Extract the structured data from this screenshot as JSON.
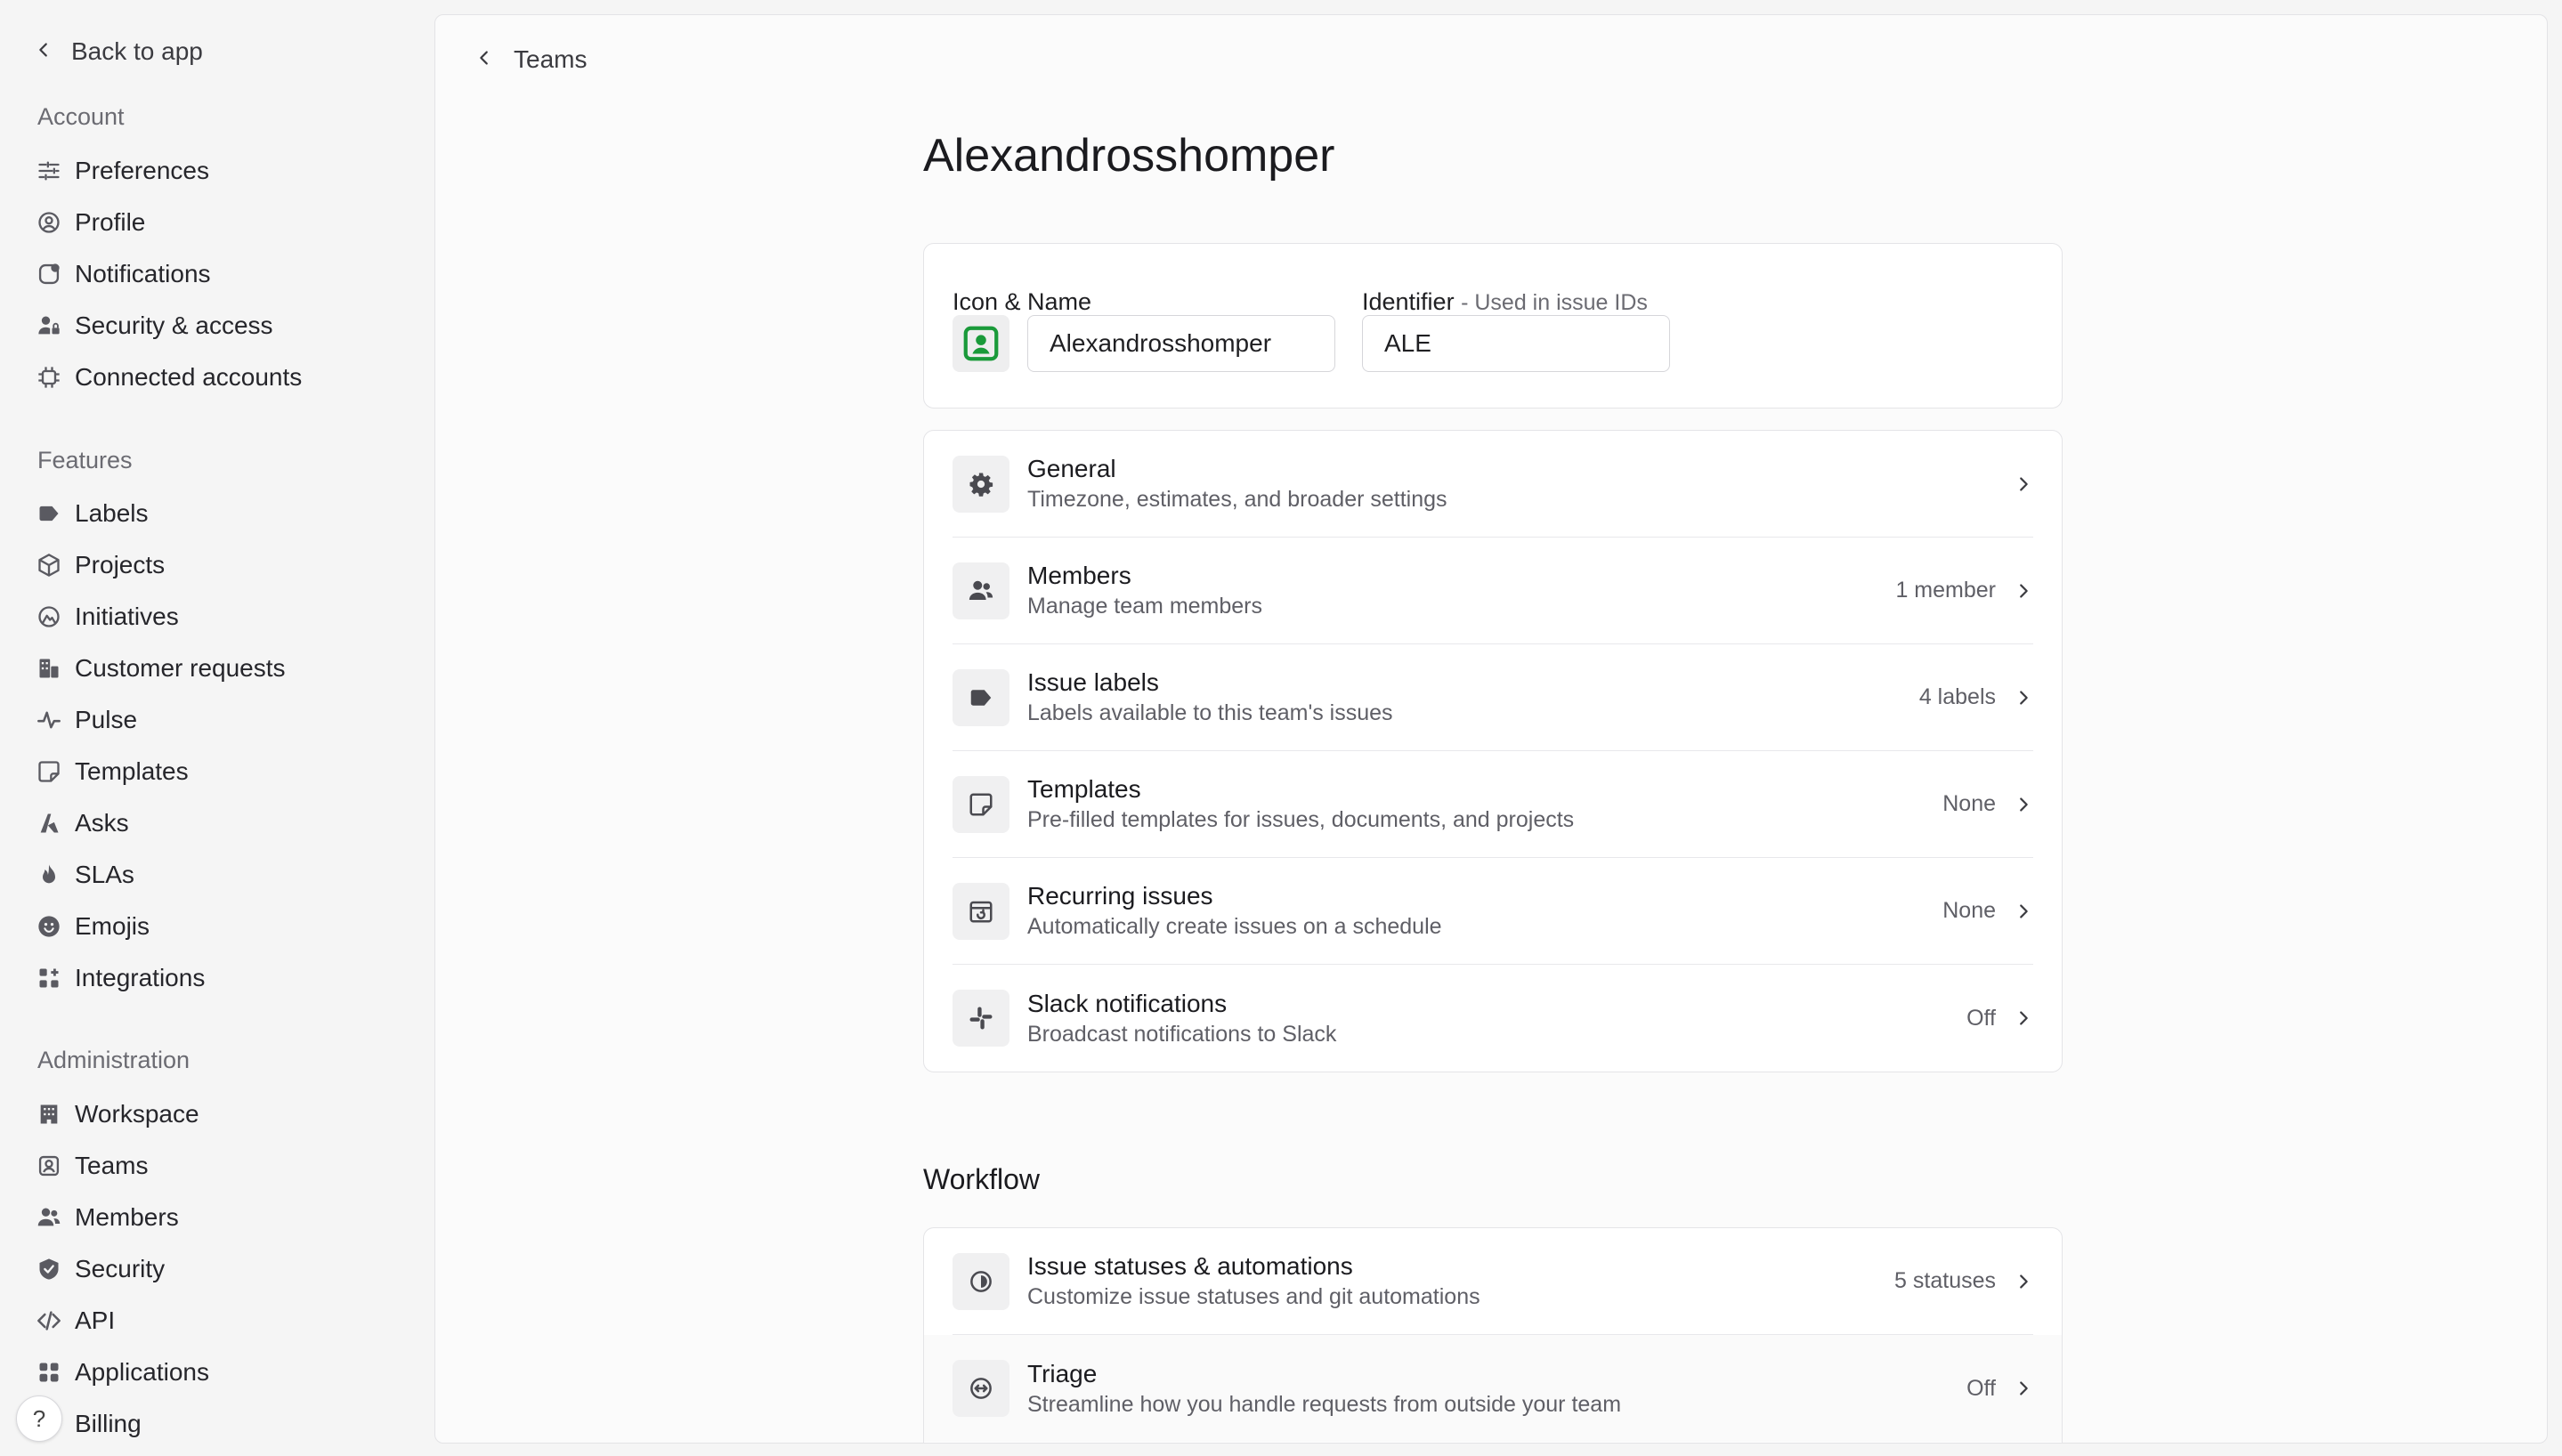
{
  "sidebar": {
    "back_label": "Back to app",
    "account": {
      "title": "Account",
      "items": [
        {
          "label": "Preferences"
        },
        {
          "label": "Profile"
        },
        {
          "label": "Notifications"
        },
        {
          "label": "Security & access"
        },
        {
          "label": "Connected accounts"
        }
      ]
    },
    "features": {
      "title": "Features",
      "items": [
        {
          "label": "Labels"
        },
        {
          "label": "Projects"
        },
        {
          "label": "Initiatives"
        },
        {
          "label": "Customer requests"
        },
        {
          "label": "Pulse"
        },
        {
          "label": "Templates"
        },
        {
          "label": "Asks"
        },
        {
          "label": "SLAs"
        },
        {
          "label": "Emojis"
        },
        {
          "label": "Integrations"
        }
      ]
    },
    "administration": {
      "title": "Administration",
      "items": [
        {
          "label": "Workspace"
        },
        {
          "label": "Teams"
        },
        {
          "label": "Members"
        },
        {
          "label": "Security"
        },
        {
          "label": "API"
        },
        {
          "label": "Applications"
        },
        {
          "label": "Billing"
        }
      ]
    },
    "help_label": "?"
  },
  "main": {
    "breadcrumb": "Teams",
    "title": "Alexandrosshomper",
    "identity": {
      "icon_name_label": "Icon & Name",
      "name_value": "Alexandrosshomper",
      "identifier_label": "Identifier",
      "identifier_hint": "Used in issue IDs",
      "identifier_value": "ALE",
      "icon_color": "#1a9a3a"
    },
    "settings": [
      {
        "title": "General",
        "desc": "Timezone, estimates, and broader settings",
        "value": ""
      },
      {
        "title": "Members",
        "desc": "Manage team members",
        "value": "1 member"
      },
      {
        "title": "Issue labels",
        "desc": "Labels available to this team's issues",
        "value": "4 labels"
      },
      {
        "title": "Templates",
        "desc": "Pre-filled templates for issues, documents, and projects",
        "value": "None"
      },
      {
        "title": "Recurring issues",
        "desc": "Automatically create issues on a schedule",
        "value": "None"
      },
      {
        "title": "Slack notifications",
        "desc": "Broadcast notifications to Slack",
        "value": "Off"
      }
    ],
    "workflow": {
      "heading": "Workflow",
      "items": [
        {
          "title": "Issue statuses & automations",
          "desc": "Customize issue statuses and git automations",
          "value": "5 statuses"
        },
        {
          "title": "Triage",
          "desc": "Streamline how you handle requests from outside your team",
          "value": "Off"
        }
      ]
    }
  }
}
